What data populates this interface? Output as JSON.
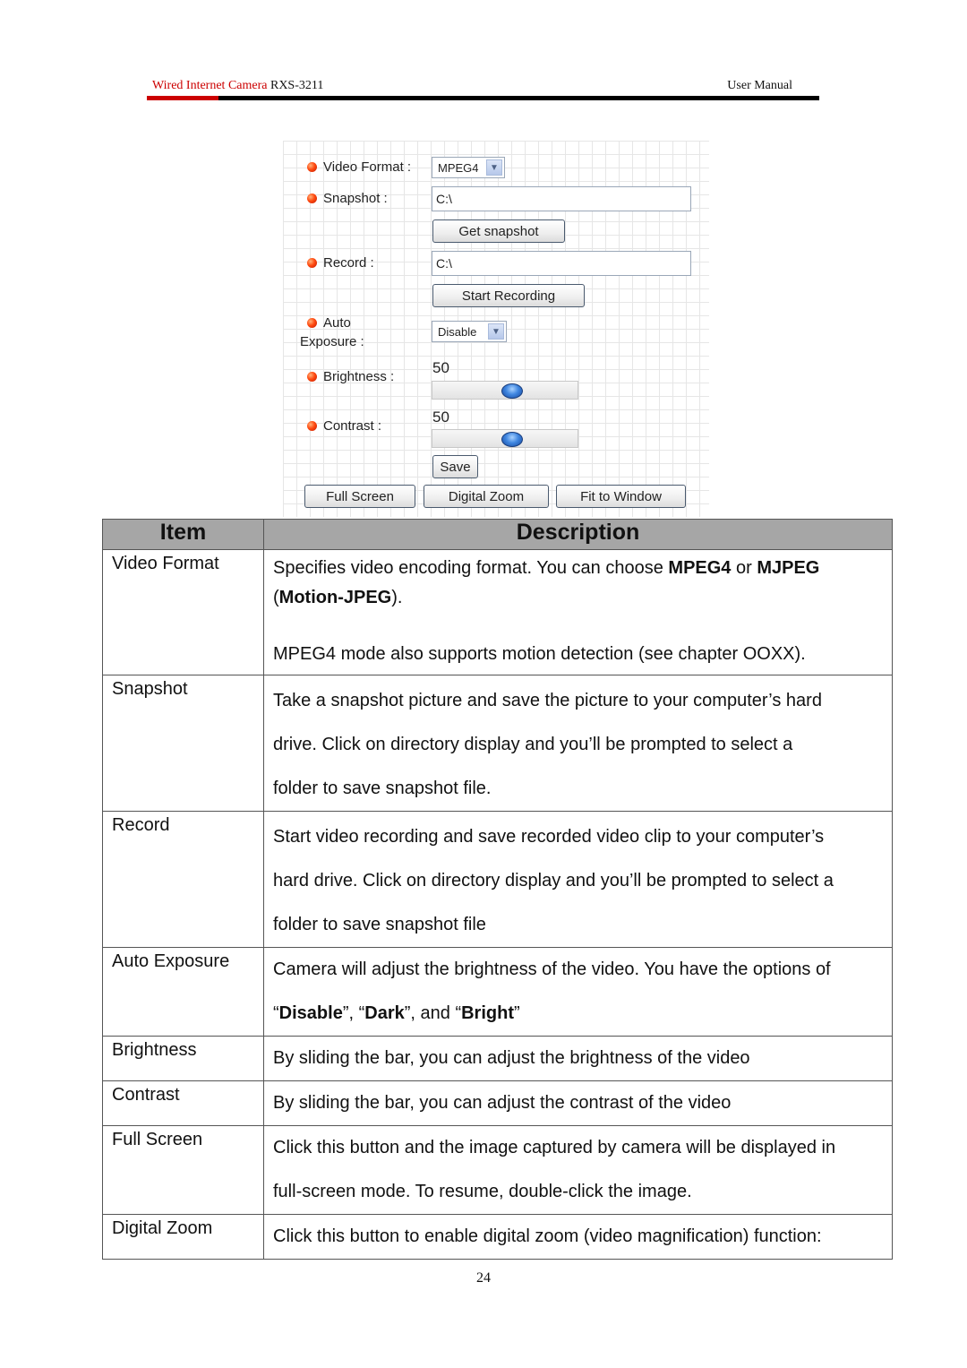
{
  "header": {
    "brand": "Wired Internet Camera",
    "model": "RXS-3211",
    "doc_type": "User Manual",
    "accent_color": "#cc0000"
  },
  "panel": {
    "video_format": {
      "label": "Video Format :",
      "value": "MPEG4"
    },
    "snapshot": {
      "label": "Snapshot :",
      "path": "C:\\",
      "button": "Get snapshot"
    },
    "record": {
      "label": "Record :",
      "path": "C:\\",
      "button": "Start Recording"
    },
    "auto_exposure": {
      "label_line1": "Auto",
      "label_line2": "Exposure :",
      "value": "Disable"
    },
    "brightness": {
      "label": "Brightness :",
      "value": "50",
      "level_percent": 50
    },
    "contrast": {
      "label": "Contrast :",
      "value": "50",
      "level_percent": 50
    },
    "save_button": "Save",
    "bottom_buttons": [
      "Full Screen",
      "Digital Zoom",
      "Fit to Window"
    ]
  },
  "table": {
    "headers": [
      "Item",
      "Description"
    ],
    "rows": [
      {
        "item": "Video Format",
        "desc": [
          [
            {
              "t": "Specifies video encoding format. You can choose "
            },
            {
              "t": "MPEG4",
              "b": true
            },
            {
              "t": " or "
            },
            {
              "t": "MJPEG",
              "b": true
            }
          ],
          [
            {
              "t": "("
            },
            {
              "t": "Motion-JPEG",
              "b": true
            },
            {
              "t": ")."
            }
          ],
          [
            {
              "t": ""
            }
          ],
          [
            {
              "t": "MPEG4 mode also supports motion detection (see chapter OOXX)."
            }
          ]
        ]
      },
      {
        "item": "Snapshot",
        "desc": [
          [
            {
              "t": "Take a snapshot picture and save the picture to your computer’s hard"
            }
          ],
          [
            {
              "t": "drive. Click on directory display and you’ll be prompted to select a"
            }
          ],
          [
            {
              "t": "folder to save snapshot file."
            }
          ]
        ]
      },
      {
        "item": "Record",
        "desc": [
          [
            {
              "t": "Start video recording and save recorded video clip to your computer’s"
            }
          ],
          [
            {
              "t": "hard drive. Click on directory display and you’ll be prompted to select a"
            }
          ],
          [
            {
              "t": "folder to save snapshot file"
            }
          ]
        ]
      },
      {
        "item": "Auto Exposure",
        "desc": [
          [
            {
              "t": "Camera will adjust the brightness of the video. You have the options of"
            }
          ],
          [
            {
              "t": "“"
            },
            {
              "t": "Disable",
              "b": true
            },
            {
              "t": "”, “"
            },
            {
              "t": "Dark",
              "b": true
            },
            {
              "t": "”, and “"
            },
            {
              "t": "Bright",
              "b": true
            },
            {
              "t": "”"
            }
          ]
        ]
      },
      {
        "item": "Brightness",
        "desc": [
          [
            {
              "t": "By sliding the bar, you can adjust the brightness of the video"
            }
          ]
        ]
      },
      {
        "item": "Contrast",
        "desc": [
          [
            {
              "t": "By sliding the bar, you can adjust the contrast of the video"
            }
          ]
        ]
      },
      {
        "item": "Full Screen",
        "desc": [
          [
            {
              "t": "Click this button and the image captured by camera will be displayed in"
            }
          ],
          [
            {
              "t": "full-screen mode. To resume, double-click the image."
            }
          ]
        ]
      },
      {
        "item": "Digital Zoom",
        "desc": [
          [
            {
              "t": "Click this button to enable digital zoom (video magnification) function:"
            }
          ]
        ]
      }
    ]
  },
  "footer": {
    "page_number": "24"
  }
}
